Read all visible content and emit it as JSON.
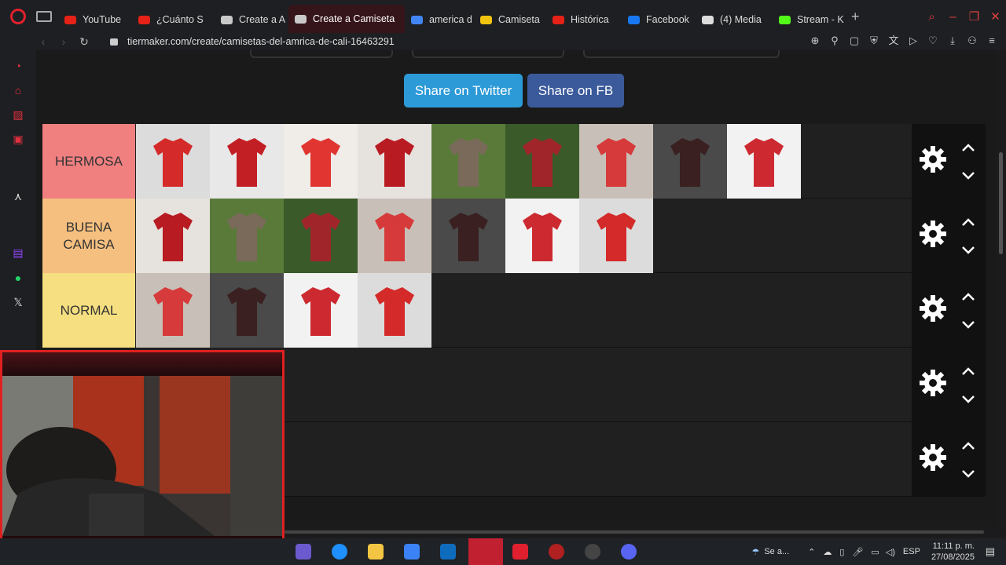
{
  "browser": {
    "tabs": [
      {
        "label": "YouTube",
        "color": "#e62117"
      },
      {
        "label": "¿Cuánto S",
        "color": "#e62117"
      },
      {
        "label": "Create a A",
        "color": "#c9c9c9"
      },
      {
        "label": "Create a Camiseta",
        "color": "#c9c9c9",
        "active": true
      },
      {
        "label": "america d",
        "color": "#4285f4"
      },
      {
        "label": "Camiseta",
        "color": "#f1c40f"
      },
      {
        "label": "Histórica",
        "color": "#e62117"
      },
      {
        "label": "Facebook",
        "color": "#1877f2"
      },
      {
        "label": "(4) Media",
        "color": "#dddddd"
      },
      {
        "label": "Stream - K",
        "color": "#53fc18"
      }
    ],
    "url": "tiermaker.com/create/camisetas-del-amrica-de-cali-16463291"
  },
  "share": {
    "twitter": "Share on Twitter",
    "facebook": "Share on FB"
  },
  "tiers": [
    {
      "label": "HERMOSA",
      "color": "#f07f80",
      "items": 9
    },
    {
      "label": "BUENA\nCAMISA",
      "color": "#f5bf7f",
      "items": 7
    },
    {
      "label": "NORMAL",
      "color": "#f5df80",
      "items": 4
    },
    {
      "label": "",
      "color": "#1a1a1a",
      "items": 0
    },
    {
      "label": "",
      "color": "#1a1a1a",
      "items": 0
    }
  ],
  "taskbar": {
    "weather": "Se a...",
    "lang": "ESP",
    "time": "11:11 p. m.",
    "date": "27/08/2025"
  }
}
